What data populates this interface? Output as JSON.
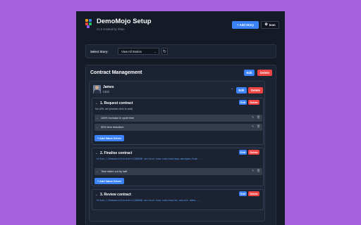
{
  "app": {
    "title": "DemoMojo Setup",
    "subtitle": "v1.0 created by Shao",
    "add_story_label": "+ Add Story",
    "icon_button_label": "Icon"
  },
  "selector": {
    "label": "Select Story:",
    "value": "View All Stories"
  },
  "section": {
    "title": "Contract Management",
    "edit_label": "Edit",
    "delete_label": "Delete"
  },
  "persona": {
    "name": "James",
    "role": "CEO",
    "edit_label": "Edit",
    "delete_label": "Delete"
  },
  "stories": [
    {
      "title": "1.  Request contract",
      "description": "No URL set (double-click to add)",
      "edit_label": "Edit",
      "delete_label": "Delete",
      "drivers": [
        "100% increase in cycle time",
        "50% time reduction"
      ],
      "add_driver_label": "+ Add Value Driver"
    },
    {
      "title": "2.  Finalise contract",
      "url": "https://demoaccelerator1128006.service-now.com/now/app-manager/hom...",
      "edit_label": "Edit",
      "delete_label": "Delete",
      "drivers": [
        "Time taken cut by half"
      ],
      "add_driver_label": "+ Add Value Driver"
    },
    {
      "title": "3.  Review contract",
      "url": "https://demoaccelerator1128006.service-now.com/now/ai-assist-admi...",
      "edit_label": "Edit",
      "delete_label": "Delete"
    }
  ],
  "colors": {
    "background": "#a561db",
    "panel": "#141a26",
    "primary": "#3b82f6",
    "danger": "#ef4444"
  },
  "icons": {
    "logo": "colored-blocks-logo",
    "refresh": "refresh-icon",
    "edit": "pencil-icon",
    "delete": "trash-icon",
    "collapse": "chevron-down-icon"
  }
}
